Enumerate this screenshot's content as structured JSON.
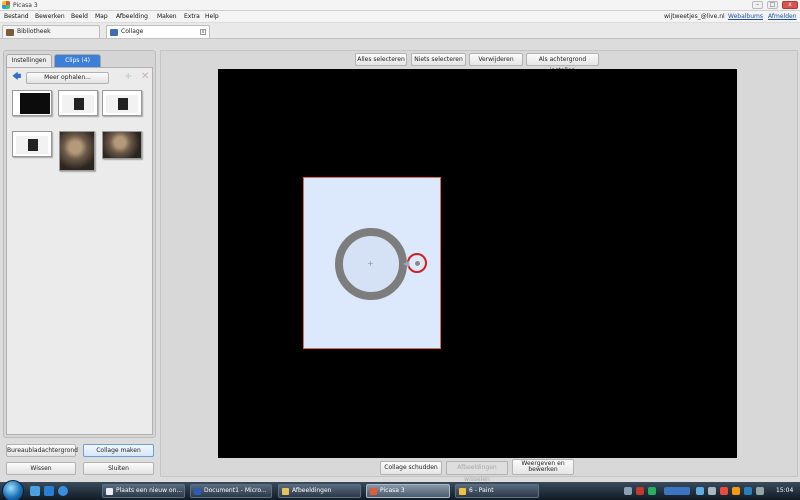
{
  "window": {
    "title": "Picasa 3",
    "controls": {
      "minimize": "–",
      "maximize": "□",
      "close": "x"
    }
  },
  "menu": {
    "items": [
      "Bestand",
      "Bewerken",
      "Beeld",
      "Map",
      "Afbeelding",
      "Maken",
      "Extra",
      "Help"
    ],
    "account": "wijtweetjes_@live.nl",
    "links": [
      "Webalbums",
      "Afmelden"
    ]
  },
  "tabs": [
    {
      "label": "Bibliotheek",
      "color": "#7a5b3a"
    },
    {
      "label": "Collage",
      "color": "#3a6fb5",
      "close": "x"
    }
  ],
  "left_panel": {
    "tabs": [
      "Instellingen",
      "Clips (4)"
    ],
    "get_more": "Meer ophalen...",
    "add_icon": "+",
    "remove_icon": "✕",
    "back_icon": "🡄",
    "buttons": [
      "Bureaubladachtergrond",
      "Collage maken",
      "Wissen",
      "Sluiten"
    ]
  },
  "toolbar": {
    "top_buttons": [
      "Alles selecteren",
      "Niets selecteren",
      "Verwijderen",
      "Als achtergrond instellen"
    ],
    "bottom_buttons": [
      "Collage schudden",
      "Afbeeldingen wisselen",
      "Weergeven en bewerken"
    ]
  },
  "canvas": {
    "background": "#000000",
    "photo_background": "#dce8fb",
    "photo_border": "#e06a44",
    "crosshair": "+"
  },
  "taskbar": {
    "tasks": [
      {
        "label": "Plaats een nieuw on...",
        "color": "#e8eef5"
      },
      {
        "label": "Document1 - Micro...",
        "color": "#2b5cb8"
      },
      {
        "label": "Afbeeldingen",
        "color": "#e8c25a"
      },
      {
        "label": "Picasa 3",
        "color": "#e05c3a"
      },
      {
        "label": "6 - Paint",
        "color": "#f0c040"
      }
    ],
    "clock": "15:04"
  }
}
